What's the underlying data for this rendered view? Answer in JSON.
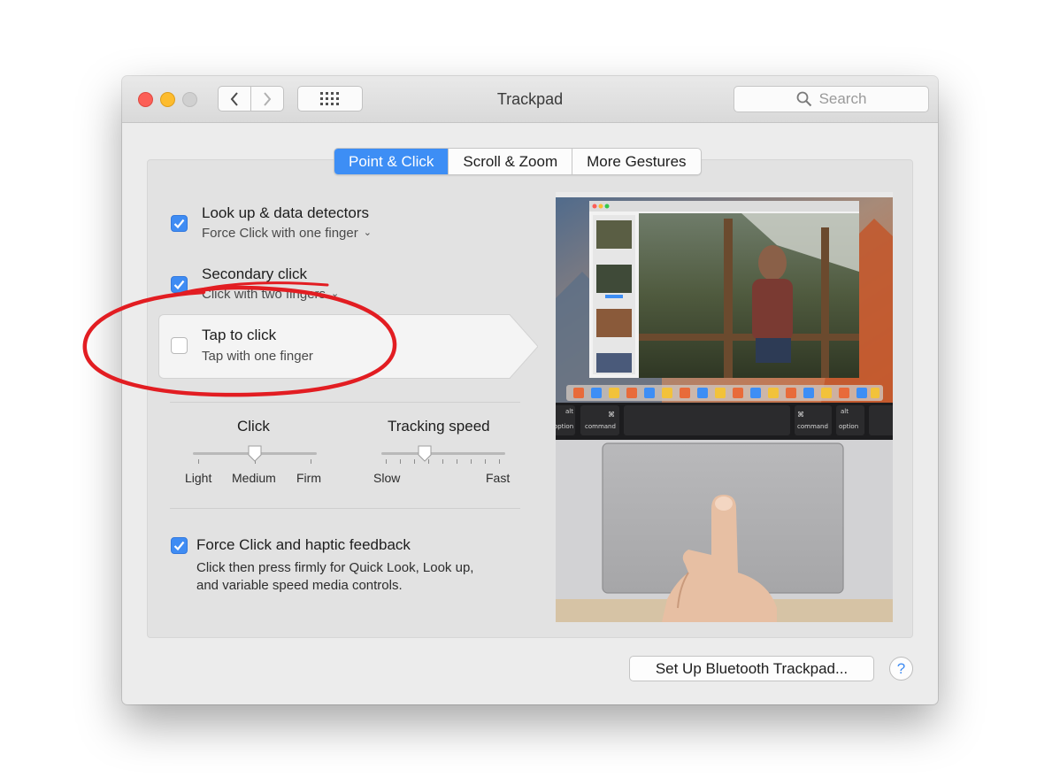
{
  "window": {
    "title": "Trackpad"
  },
  "toolbar": {
    "search_placeholder": "Search"
  },
  "tabs": [
    {
      "label": "Point & Click",
      "active": true
    },
    {
      "label": "Scroll & Zoom",
      "active": false
    },
    {
      "label": "More Gestures",
      "active": false
    }
  ],
  "options": {
    "lookup": {
      "title": "Look up & data detectors",
      "subtitle": "Force Click with one finger",
      "checked": true
    },
    "secondary": {
      "title": "Secondary click",
      "subtitle": "Click with two fingers",
      "checked": true
    },
    "tap": {
      "title": "Tap to click",
      "subtitle": "Tap with one finger",
      "checked": false
    }
  },
  "sliders": {
    "click": {
      "label": "Click",
      "ticks": [
        "Light",
        "Medium",
        "Firm"
      ],
      "value": "Medium"
    },
    "tracking": {
      "label": "Tracking speed",
      "min_label": "Slow",
      "max_label": "Fast",
      "position": 0.35
    }
  },
  "force_click": {
    "title": "Force Click and haptic feedback",
    "description_line1": "Click then press firmly for Quick Look, Look up,",
    "description_line2": "and variable speed media controls.",
    "checked": true
  },
  "preview": {
    "keys": {
      "left_alt": "alt",
      "left_option": "option",
      "left_command": "command",
      "right_command": "command",
      "right_alt": "alt",
      "right_option": "option"
    }
  },
  "buttons": {
    "setup_bluetooth": "Set Up Bluetooth Trackpad...",
    "help": "?"
  },
  "colors": {
    "accent": "#3d8ef5",
    "annotation": "#e21d22"
  }
}
